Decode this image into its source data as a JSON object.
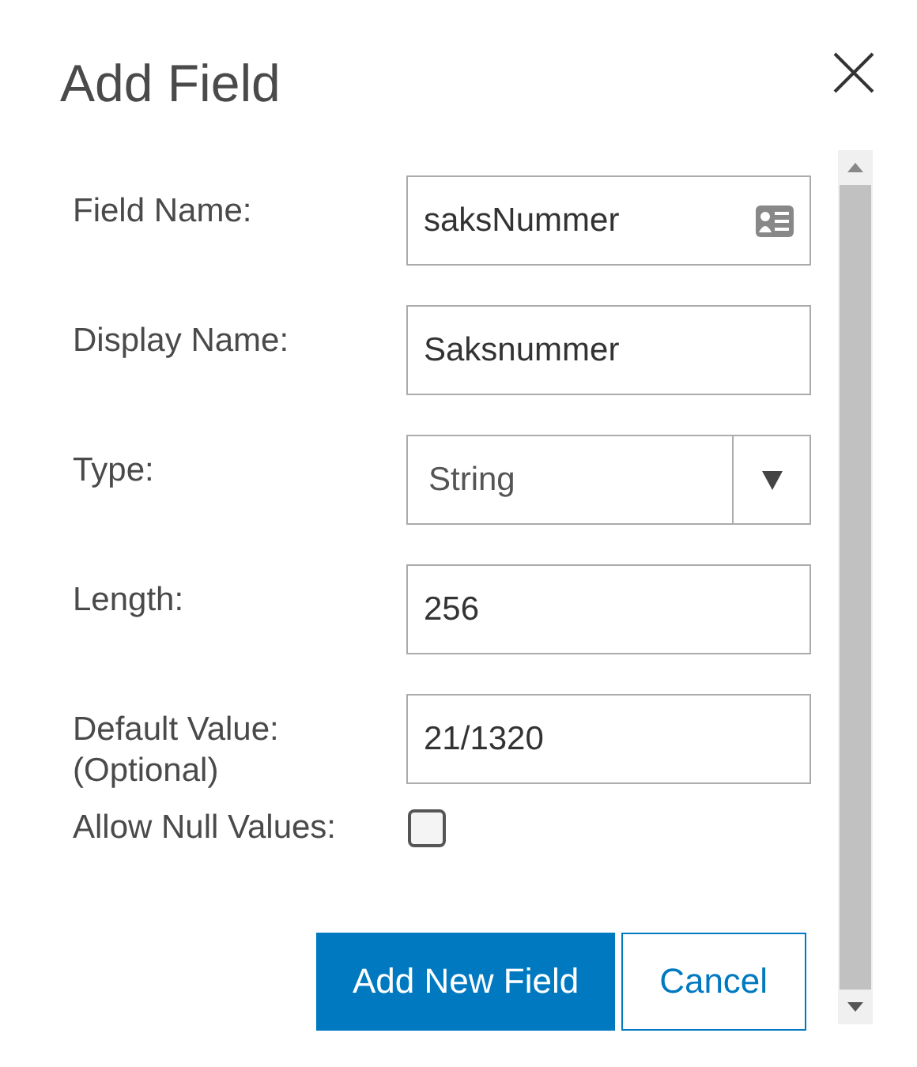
{
  "dialog": {
    "title": "Add Field"
  },
  "fields": [
    {
      "kind": "text",
      "label": "Field Name:",
      "value": "saksNummer",
      "has_card_icon": true
    },
    {
      "kind": "text",
      "label": "Display Name:",
      "value": "Saksnummer"
    },
    {
      "kind": "select",
      "label": "Type:",
      "value": "String"
    },
    {
      "kind": "text",
      "label": "Length:",
      "value": "256"
    },
    {
      "kind": "text",
      "label": "Default Value:",
      "label_line_2": "(Optional)",
      "value": "21/1320"
    },
    {
      "kind": "checkbox",
      "label": "Allow Null Values:",
      "checked": false
    }
  ],
  "buttons": [
    {
      "label": "Add New Field",
      "kind": "primary"
    },
    {
      "label": "Cancel",
      "kind": "secondary"
    }
  ]
}
